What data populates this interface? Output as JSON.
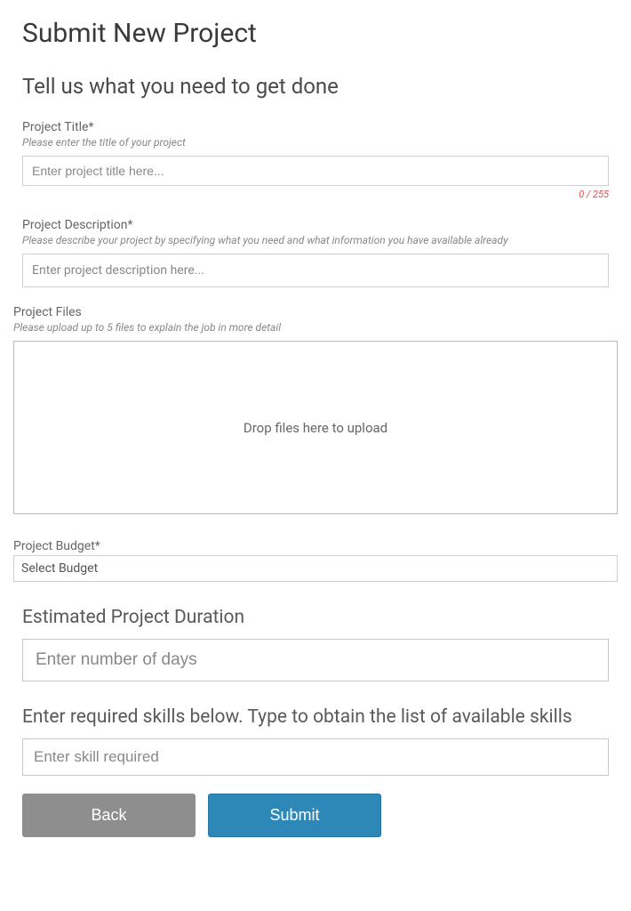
{
  "header": {
    "title": "Submit New Project",
    "subtitle": "Tell us what you need to get done"
  },
  "projectTitle": {
    "label": "Project Title*",
    "hint": "Please enter the title of your project",
    "placeholder": "Enter project title here...",
    "counter": "0 / 255"
  },
  "projectDescription": {
    "label": "Project Description*",
    "hint": "Please describe your project by specifying what you need and what information you have available already",
    "placeholder": "Enter project description here..."
  },
  "projectFiles": {
    "label": "Project Files",
    "hint": "Please upload up to 5 files to explain the job in more detail",
    "dropText": "Drop files here to upload"
  },
  "projectBudget": {
    "label": "Project Budget*",
    "selected": "Select Budget"
  },
  "duration": {
    "label": "Estimated Project Duration",
    "placeholder": "Enter number of days"
  },
  "skills": {
    "label": "Enter required skills below. Type to obtain the list of available skills",
    "placeholder": "Enter skill required"
  },
  "buttons": {
    "back": "Back",
    "submit": "Submit"
  }
}
